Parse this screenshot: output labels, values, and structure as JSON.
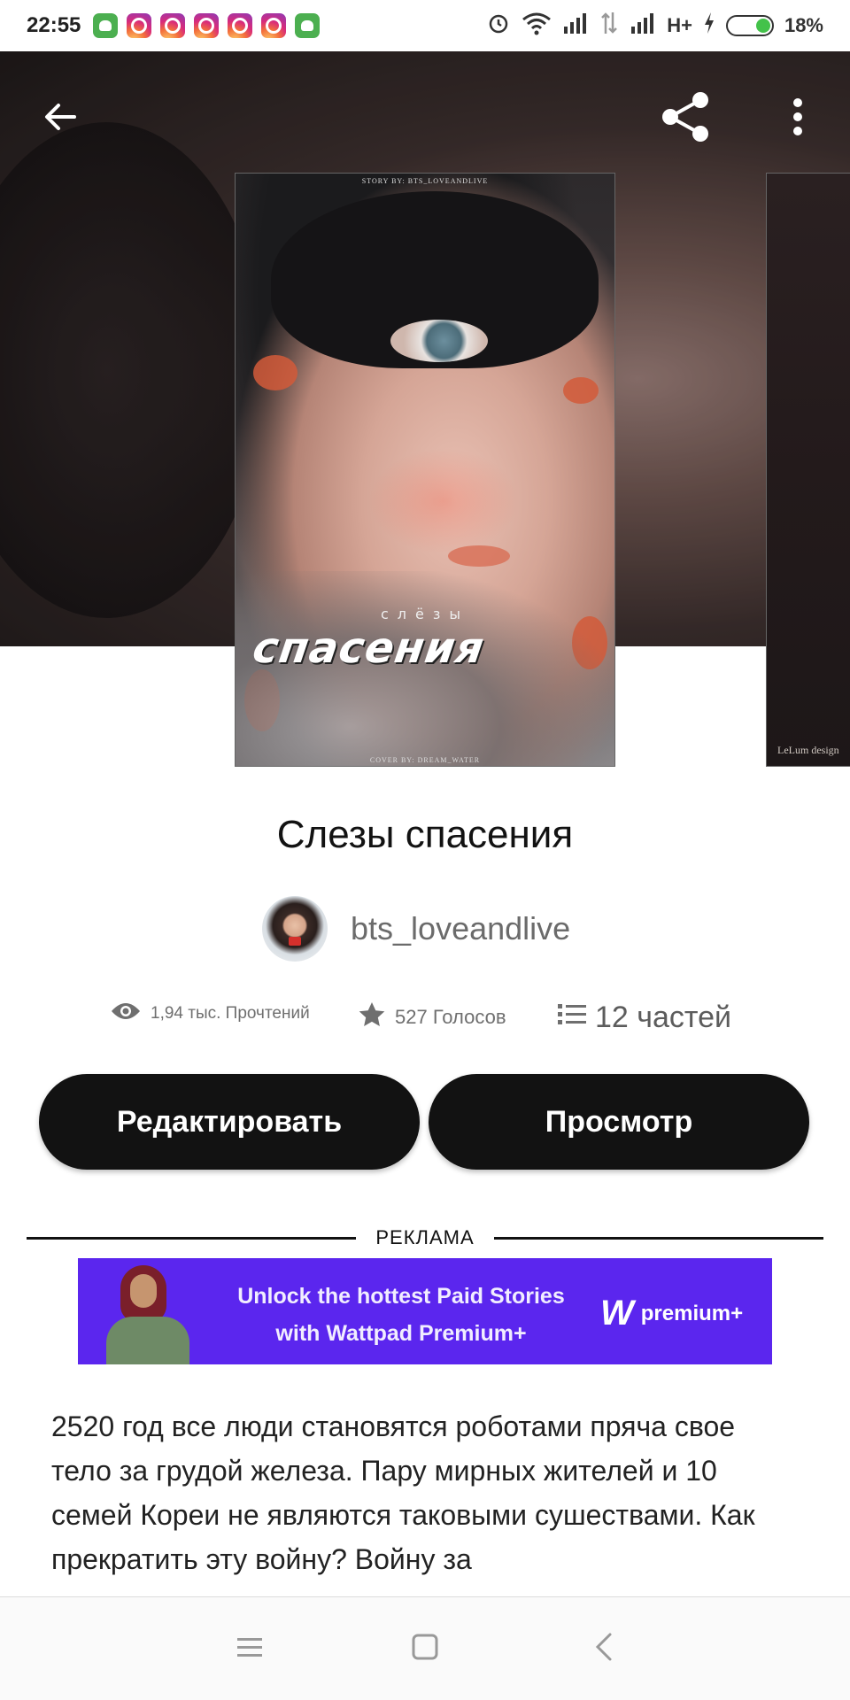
{
  "status_bar": {
    "time": "22:55",
    "network": "H+",
    "battery_percent": "18%"
  },
  "story": {
    "title": "Слезы спасения",
    "author": "bts_loveandlive",
    "stats": {
      "reads": "1,94 тыс. Прочтений",
      "votes": "527 Голосов",
      "parts": "12 частей"
    },
    "description": "2520 год все люди становятся роботами пряча свое тело за грудой железа. Пару мирных жителей и 10 семей Кореи не являются таковыми сушествами. Как прекратить эту войну? Войну за"
  },
  "cover": {
    "credit_top": "STORY BY: BTS_LOVEANDLIVE",
    "subtitle": "слёзы",
    "title": "спасения",
    "credit_bottom": "COVER BY: DREAM_WATER"
  },
  "next_cover": {
    "credit": "LeLum design"
  },
  "actions": {
    "edit": "Редактировать",
    "preview": "Просмотр"
  },
  "ad": {
    "label": "РЕКЛАМА",
    "line1": "Unlock the hottest Paid Stories",
    "line2": "with Wattpad Premium+",
    "logo_text": "premium+",
    "background": "#5b26ee"
  },
  "icons": {
    "back": "arrow-left-icon",
    "share": "share-icon",
    "menu": "more-vertical-icon",
    "reads": "eye-icon",
    "votes": "star-icon",
    "parts": "list-icon"
  }
}
